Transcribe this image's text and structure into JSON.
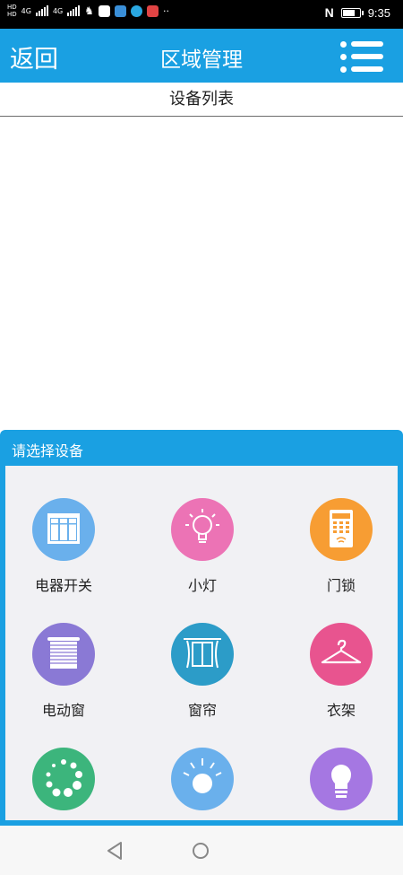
{
  "status_bar": {
    "left_labels": [
      "HD",
      "HD",
      "4G",
      "4G"
    ],
    "overflow": "··",
    "time": "9:35",
    "battery_level": 0.8
  },
  "header": {
    "back_label": "返回",
    "title": "区域管理",
    "menu_icon": "list-menu-icon"
  },
  "subheader": {
    "title": "设备列表"
  },
  "device_picker": {
    "title": "请选择设备",
    "devices": [
      {
        "label": "电器开关",
        "icon": "window-panel-icon",
        "color": "#6ab0ec"
      },
      {
        "label": "小灯",
        "icon": "light-bulb-icon",
        "color": "#ec73b5"
      },
      {
        "label": "门锁",
        "icon": "door-lock-icon",
        "color": "#f79d33"
      },
      {
        "label": "电动窗",
        "icon": "roller-blind-icon",
        "color": "#8a79d5"
      },
      {
        "label": "窗帘",
        "icon": "curtain-icon",
        "color": "#2c9cc8"
      },
      {
        "label": "衣架",
        "icon": "clothes-hanger-icon",
        "color": "#e8548f"
      },
      {
        "label": "",
        "icon": "dots-ring-icon",
        "color": "#3cb57c"
      },
      {
        "label": "",
        "icon": "sun-light-icon",
        "color": "#6ab0ec"
      },
      {
        "label": "",
        "icon": "led-bulb-icon",
        "color": "#a577e2"
      }
    ]
  },
  "nav_bar": {
    "back_icon": "triangle-back-icon",
    "home_icon": "circle-home-icon"
  }
}
